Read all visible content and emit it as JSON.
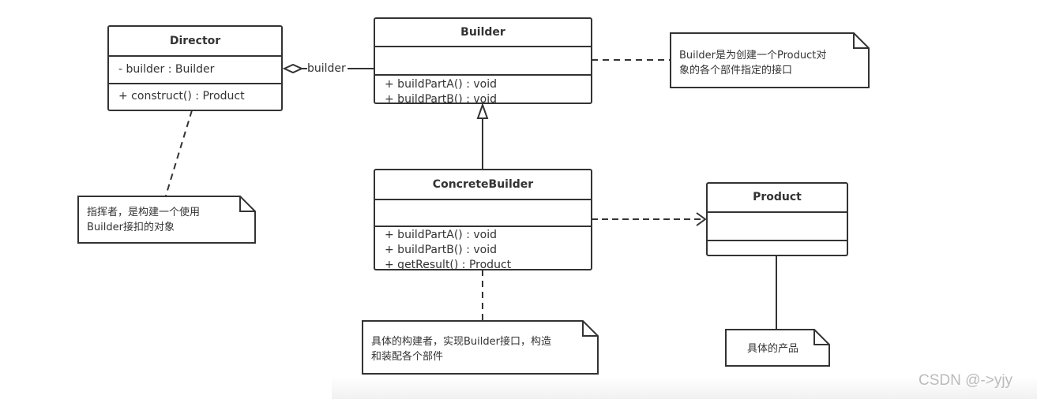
{
  "classes": {
    "director": {
      "name": "Director",
      "attributes": [
        "- builder : Builder"
      ],
      "operations": [
        "+ construct()  : Product"
      ]
    },
    "builder": {
      "name": "Builder",
      "attributes": [],
      "operations": [
        "+ buildPartA() : void",
        "+ buildPartB() : void"
      ]
    },
    "concrete_builder": {
      "name": "ConcreteBuilder",
      "attributes": [],
      "operations": [
        "+ buildPartA() : void",
        "+ buildPartB() : void",
        "+ getResult() : Product"
      ]
    },
    "product": {
      "name": "Product",
      "attributes": [],
      "operations": []
    }
  },
  "relations": {
    "aggregation_label": "builder"
  },
  "notes": {
    "builder": [
      "Builder是为创建一个Product对",
      "象的各个部件指定的接口"
    ],
    "director": [
      "指挥者，是构建一个使用",
      "Builder接扣的对象"
    ],
    "concrete_builder": [
      "具体的构建者，实现Builder接口，构造",
      "和装配各个部件"
    ],
    "product": [
      "具体的产品"
    ]
  },
  "watermark": "CSDN @->yjy"
}
